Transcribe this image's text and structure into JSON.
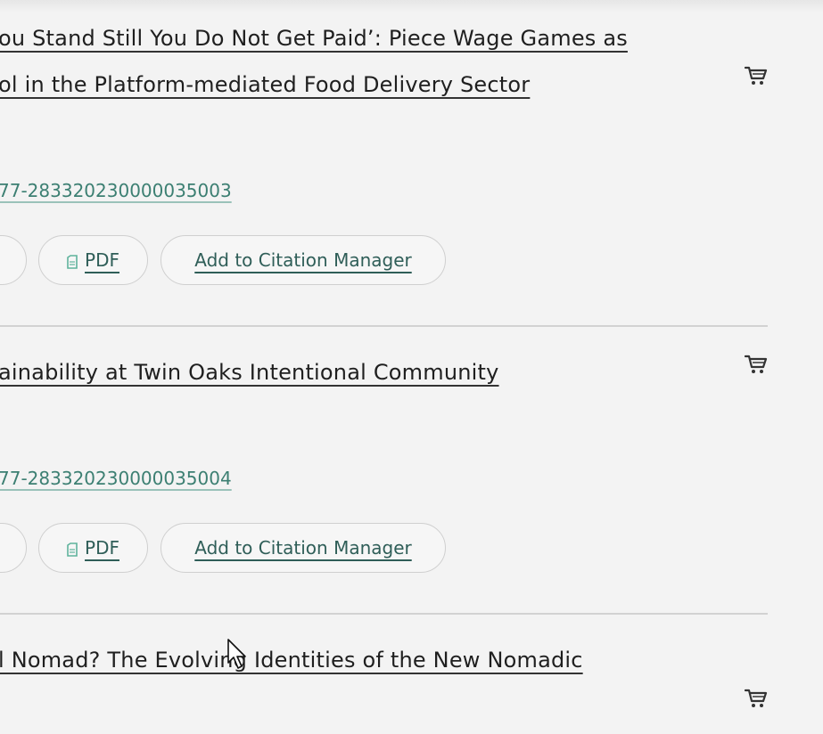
{
  "results": [
    {
      "title_lines": [
        "ou Stand Still You Do Not Get Paid’: Piece Wage Games as",
        "ol in the Platform-mediated Food Delivery Sector"
      ],
      "doi": "77-283320230000035003",
      "pdf_label": "PDF",
      "citation_label": "Add to Citation Manager",
      "cart_icon": "shopping-cart-icon"
    },
    {
      "title_lines": [
        "ainability at Twin Oaks Intentional Community"
      ],
      "doi": "77-283320230000035004",
      "pdf_label": "PDF",
      "citation_label": "Add to Citation Manager",
      "cart_icon": "shopping-cart-icon"
    },
    {
      "title_lines": [
        "l Nomad? The Evolving Identities of the New Nomadic"
      ],
      "cart_icon": "shopping-cart-icon"
    }
  ],
  "colors": {
    "background": "#f3f3f3",
    "link_teal": "#3c7f72",
    "button_text": "#2f5e58",
    "pdf_icon": "#5fb39c",
    "divider": "#d2d2d2"
  }
}
